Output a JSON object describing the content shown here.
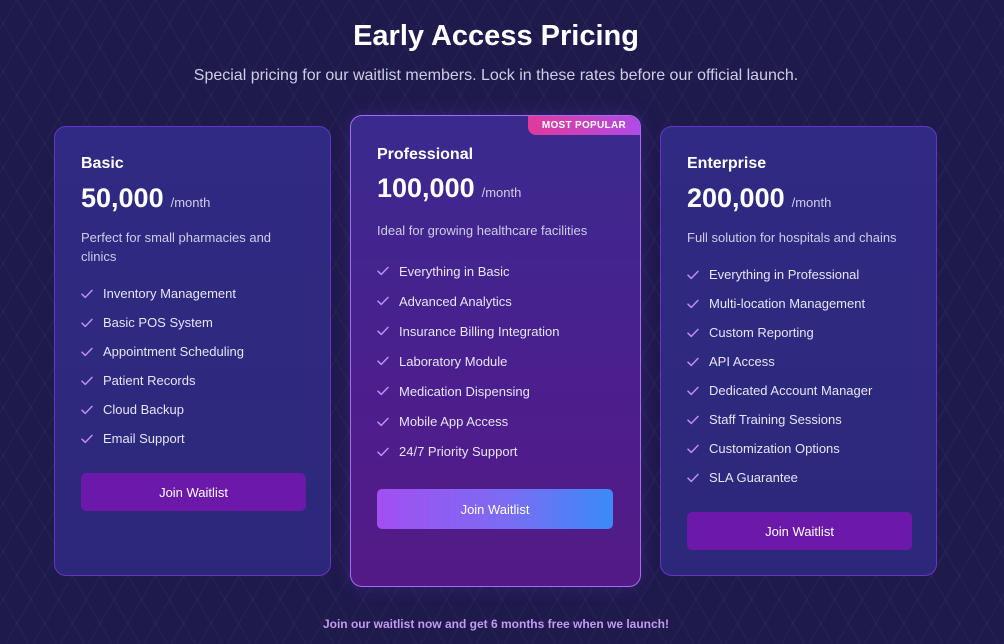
{
  "header": {
    "title": "Early Access Pricing",
    "subtitle": "Special pricing for our waitlist members. Lock in these rates before our official launch."
  },
  "plans": [
    {
      "name": "Basic",
      "price": "50,000",
      "period": "/month",
      "description": "Perfect for small pharmacies and clinics",
      "features": [
        "Inventory Management",
        "Basic POS System",
        "Appointment Scheduling",
        "Patient Records",
        "Cloud Backup",
        "Email Support"
      ],
      "button_label": "Join Waitlist"
    },
    {
      "name": "Professional",
      "badge": "MOST POPULAR",
      "price": "100,000",
      "period": "/month",
      "description": "Ideal for growing healthcare facilities",
      "features": [
        "Everything in Basic",
        "Advanced Analytics",
        "Insurance Billing Integration",
        "Laboratory Module",
        "Medication Dispensing",
        "Mobile App Access",
        "24/7 Priority Support"
      ],
      "button_label": "Join Waitlist"
    },
    {
      "name": "Enterprise",
      "price": "200,000",
      "period": "/month",
      "description": "Full solution for hospitals and chains",
      "features": [
        "Everything in Professional",
        "Multi-location Management",
        "Custom Reporting",
        "API Access",
        "Dedicated Account Manager",
        "Staff Training Sessions",
        "Customization Options",
        "SLA Guarantee"
      ],
      "button_label": "Join Waitlist"
    }
  ],
  "footer": {
    "note": "Join our waitlist now and get 6 months free when we launch!"
  },
  "icons": {
    "feature_check": "check-icon"
  },
  "colors": {
    "background": "#1e1a4c",
    "card": "#2f2b84",
    "check": "#c08cf5",
    "button": "#6c18a8",
    "badge_start": "#e13a9a",
    "badge_end": "#b04be6",
    "footer_note": "#c49af2"
  }
}
